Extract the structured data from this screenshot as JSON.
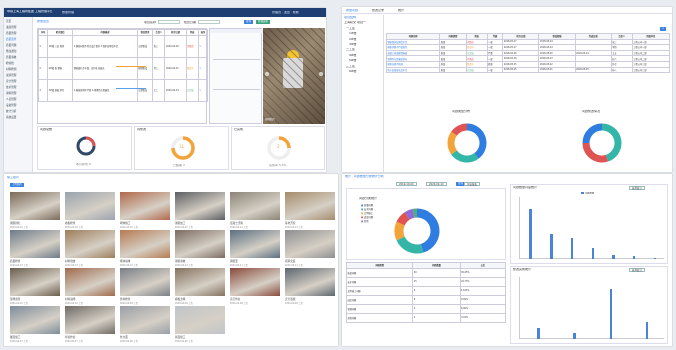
{
  "colors": {
    "accent": "#2f7de1",
    "nav": "#1f3f73",
    "orange": "#f2a33a",
    "red": "#e05353",
    "green": "#4cae7a",
    "teal": "#33b5a8",
    "navy": "#2f4a66"
  },
  "p1": {
    "logo": "中铁上海工程局集团 工程管理平台",
    "module": "质量管理",
    "title": "质量巡查",
    "user": "管理员 · 退出 · 帮助",
    "sidebar": [
      "首页",
      "进度管理",
      "质量管理",
      "质量巡查",
      "质量问题",
      "整改通知",
      "质量验收",
      "检验批",
      "材料检测",
      "试验管理",
      "安全管理",
      "技术管理",
      "资料管理",
      "人员管理",
      "设备管理",
      "统计分析",
      "系统设置"
    ],
    "filters": [
      "项目名称",
      "检查日期",
      "状态"
    ],
    "btn_query": "查询",
    "btn_add": "新增巡查",
    "table_headers": [
      "序号",
      "检查部位",
      "问题描述",
      "整改要求",
      "责任人",
      "检查日期",
      "状态",
      "操作"
    ],
    "rows": [
      {
        "no": "1",
        "part": "1#楼 三层 墙体",
        "desc": "1.钢筋间距不符合设计要求 2.保护层厚度不足",
        "req": "立即整改",
        "who": "张工",
        "date": "2020-04-16",
        "status": "待整改"
      },
      {
        "no": "2",
        "part": "2#楼 板 钢筋",
        "desc": "钢筋绑扎不牢固，部分扎丝缺失",
        "req": "限期整改",
        "who": "李工",
        "date": "2020-04-15",
        "status": "整改中"
      },
      {
        "no": "3",
        "part": "3#楼 基础 承台",
        "desc": "1.模板拼缝不严密 2.预埋件位置偏差",
        "req": "立即整改",
        "who": "王工",
        "date": "2020-04-14",
        "status": "已完成"
      }
    ],
    "photo_caption": "现场照片",
    "cards": [
      {
        "title": "问题总数",
        "value": "36",
        "sub": "本月新增 8"
      },
      {
        "title": "待整改",
        "value": "11",
        "sub": "已超期 2"
      },
      {
        "title": "已完成",
        "value": "2",
        "sub": "完成率 5.6%"
      }
    ]
  },
  "p2": {
    "tabs": [
      "质量问题",
      "整改记录",
      "统计"
    ],
    "tree_title": "项目结构",
    "tree": [
      "上海轨交 项目一",
      "一工区",
      "1#楼",
      "2#楼",
      "3#楼",
      "二工区",
      "4#楼",
      "5#楼",
      "三工区",
      "6#楼"
    ],
    "headers": [
      "问题名称",
      "问题类型",
      "状态",
      "等级",
      "检查日期",
      "整改期限",
      "完成日期",
      "责任人",
      "所属单位"
    ],
    "rows": [
      {
        "name": "钢筋保护层厚度不足",
        "type": "质量",
        "status": "待整改",
        "level": "一般",
        "d1": "2018-05-17",
        "d2": "2018-05-24",
        "d3": "",
        "who": "张三",
        "org": "工程公司一部"
      },
      {
        "name": "模板拼缝不严密漏浆",
        "type": "质量",
        "status": "整改中",
        "level": "一般",
        "d1": "2018-05-17",
        "d2": "2018-05-24",
        "d3": "",
        "who": "李四",
        "org": "工程公司一部"
      },
      {
        "name": "混凝土表面蜂窝麻面",
        "type": "质量",
        "status": "已完成",
        "level": "严重",
        "d1": "2018-05-16",
        "d2": "2018-05-20",
        "d3": "2018-05-19",
        "who": "王五",
        "org": "工程公司二部"
      },
      {
        "name": "预埋件位置偏差超标",
        "type": "质量",
        "status": "待整改",
        "level": "一般",
        "d1": "2018-05-16",
        "d2": "2018-05-23",
        "d3": "",
        "who": "赵六",
        "org": "工程公司二部"
      },
      {
        "name": "砌体灰缝不饱满",
        "type": "质量",
        "status": "整改中",
        "level": "轻微",
        "d1": "2018-05-15",
        "d2": "2018-05-22",
        "d3": "",
        "who": "钱七",
        "org": "工程公司三部"
      },
      {
        "name": "防水层搭接长度不足",
        "type": "质量",
        "status": "已完成",
        "level": "一般",
        "d1": "2018-05-15",
        "d2": "2018-05-21",
        "d3": "2018-05-20",
        "who": "孙八",
        "org": "工程公司三部"
      }
    ],
    "chart1_title": "问题类型分布",
    "chart2_title": "问题整改情况"
  },
  "p3": {
    "title": "施工照片",
    "btn": "上传照片",
    "photos": [
      {
        "cap": "钢筋绑扎",
        "sub": "2020-04-16 上传"
      },
      {
        "cap": "模板检查",
        "sub": "2020-04-16 上传"
      },
      {
        "cap": "砌体施工",
        "sub": "2020-04-15 上传"
      },
      {
        "cap": "钢筋加工",
        "sub": "2020-04-15 上传"
      },
      {
        "cap": "混凝土浇筑",
        "sub": "2020-04-14 上传"
      },
      {
        "cap": "基坑开挖",
        "sub": "2020-04-14 上传"
      },
      {
        "cap": "质量检查",
        "sub": "2020-04-13 上传"
      },
      {
        "cap": "材料堆放",
        "sub": "2020-04-13 上传"
      },
      {
        "cap": "砌块墙体",
        "sub": "2020-04-12 上传"
      },
      {
        "cap": "钢筋验收",
        "sub": "2020-04-12 上传"
      },
      {
        "cap": "钢筋笼",
        "sub": "2020-04-11 上传"
      },
      {
        "cap": "塔吊安装",
        "sub": "2020-04-11 上传"
      },
      {
        "cap": "现场巡查",
        "sub": "2020-04-10 上传"
      },
      {
        "cap": "材料进场",
        "sub": "2020-04-10 上传"
      },
      {
        "cap": "管材检查",
        "sub": "2020-04-09 上传"
      },
      {
        "cap": "模板支撑",
        "sub": "2020-04-09 上传"
      },
      {
        "cap": "高空作业",
        "sub": "2020-04-08 上传"
      },
      {
        "cap": "安全巡视",
        "sub": "2020-04-08 上传"
      },
      {
        "cap": "隧道施工",
        "sub": "2020-04-07 上传"
      },
      {
        "cap": "焊接作业",
        "sub": "2020-04-07 上传"
      },
      {
        "cap": "外立面",
        "sub": "2020-04-06 上传"
      },
      {
        "cap": "屋面施工",
        "sub": "2020-04-06 上传"
      }
    ]
  },
  "p4": {
    "title": "统计 · 问题数量分类统计分析",
    "date_from": "2019-10-04",
    "date_to": "2020-04-10",
    "btn_query": "查询",
    "btn_export": "导出报表",
    "pie_caption": "问题分类统计",
    "legend": [
      "质量问题",
      "安全问题",
      "文明施工",
      "进度问题",
      "其他"
    ],
    "headers": [
      "问题类型",
      "问题数量",
      "占比"
    ],
    "rows": [
      {
        "k": "质量问题",
        "n": "30",
        "p": "45.45%"
      },
      {
        "k": "安全问题",
        "n": "15",
        "p": "22.73%"
      },
      {
        "k": "文明施工问题",
        "n": "9",
        "p": "13.64%"
      },
      {
        "k": "进度问题",
        "n": "6",
        "p": "9.09%"
      },
      {
        "k": "管理问题",
        "n": "4",
        "p": "6.06%"
      },
      {
        "k": "其他问题",
        "n": "2",
        "p": "3.03%"
      }
    ],
    "bar1_title": "问题数量月度统计",
    "bar2_title": "整改完成统计",
    "bar_legend": "问题数量",
    "sel": "按月统计"
  },
  "chart_data": [
    {
      "type": "pie",
      "values": [
        40,
        25,
        20,
        15
      ],
      "colors": [
        "#2f7de1",
        "#33b5a8",
        "#f2a33a",
        "#e05353"
      ]
    },
    {
      "type": "pie",
      "values": [
        45,
        30,
        25
      ],
      "colors": [
        "#33b5a8",
        "#e05353",
        "#2f7de1"
      ]
    },
    {
      "type": "pie",
      "values": [
        30,
        15,
        9,
        6,
        4,
        2
      ],
      "colors": [
        "#2f7de1",
        "#33b5a8",
        "#f2a33a",
        "#e05353",
        "#8e6ad8",
        "#4cae7a"
      ]
    },
    {
      "type": "bar",
      "values": [
        36,
        18,
        15,
        8,
        3,
        2,
        1
      ]
    },
    {
      "type": "bar",
      "values": [
        2,
        1,
        9,
        3
      ]
    }
  ]
}
